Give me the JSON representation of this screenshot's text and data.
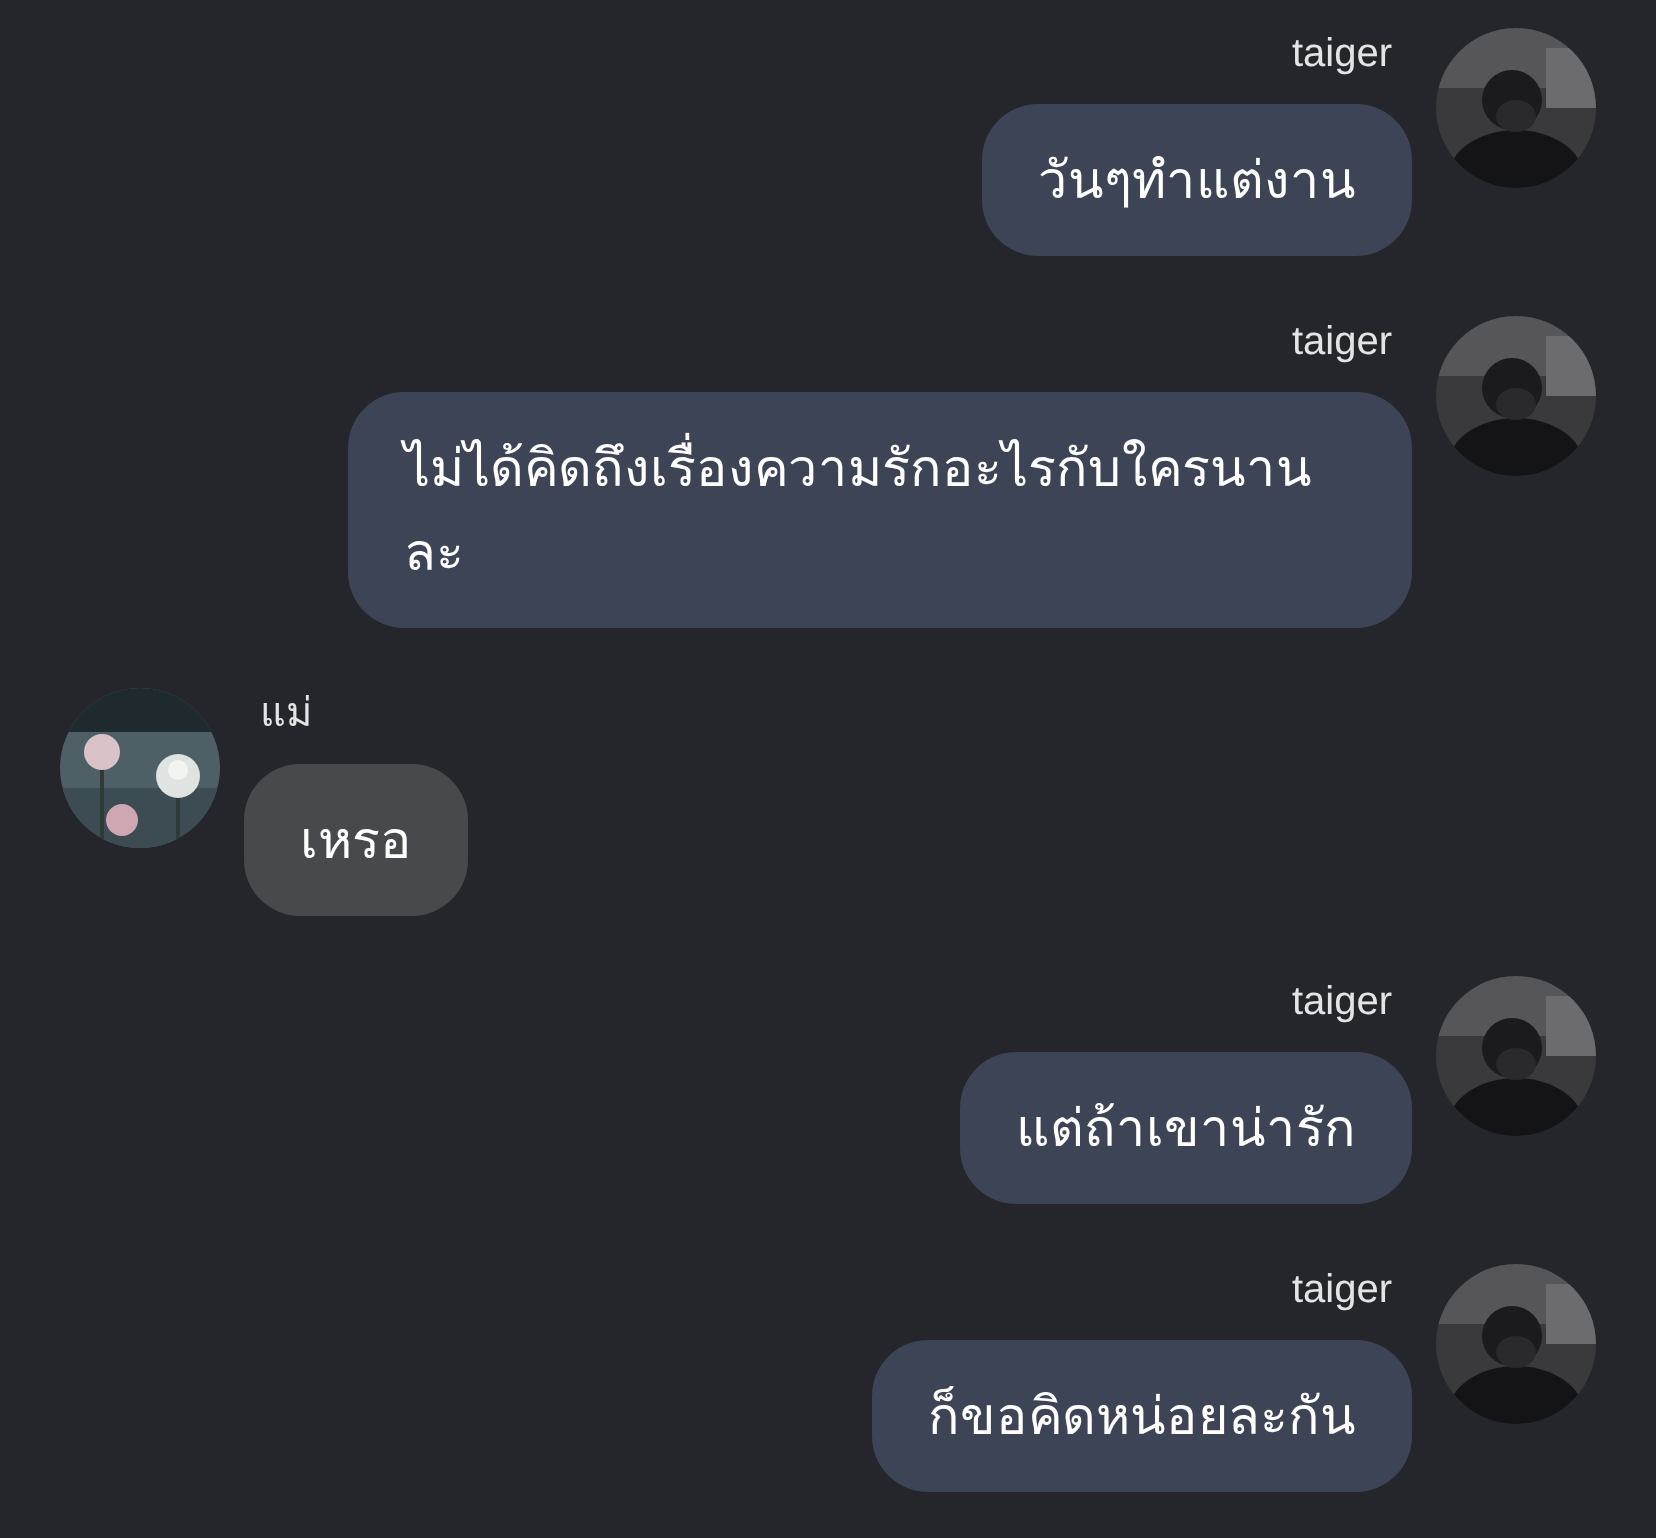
{
  "messages": [
    {
      "kind": "outgoing",
      "sender": "taiger",
      "text": "วันๆทำแต่งาน"
    },
    {
      "kind": "outgoing",
      "sender": "taiger",
      "text": "ไม่ได้คิดถึงเรื่องความรักอะไรกับใครนานละ"
    },
    {
      "kind": "incoming",
      "sender": "แม่",
      "text": "เหรอ"
    },
    {
      "kind": "outgoing",
      "sender": "taiger",
      "text": "แต่ถ้าเขาน่ารัก"
    },
    {
      "kind": "outgoing",
      "sender": "taiger",
      "text": "ก็ขอคิดหน่อยละกัน"
    }
  ]
}
